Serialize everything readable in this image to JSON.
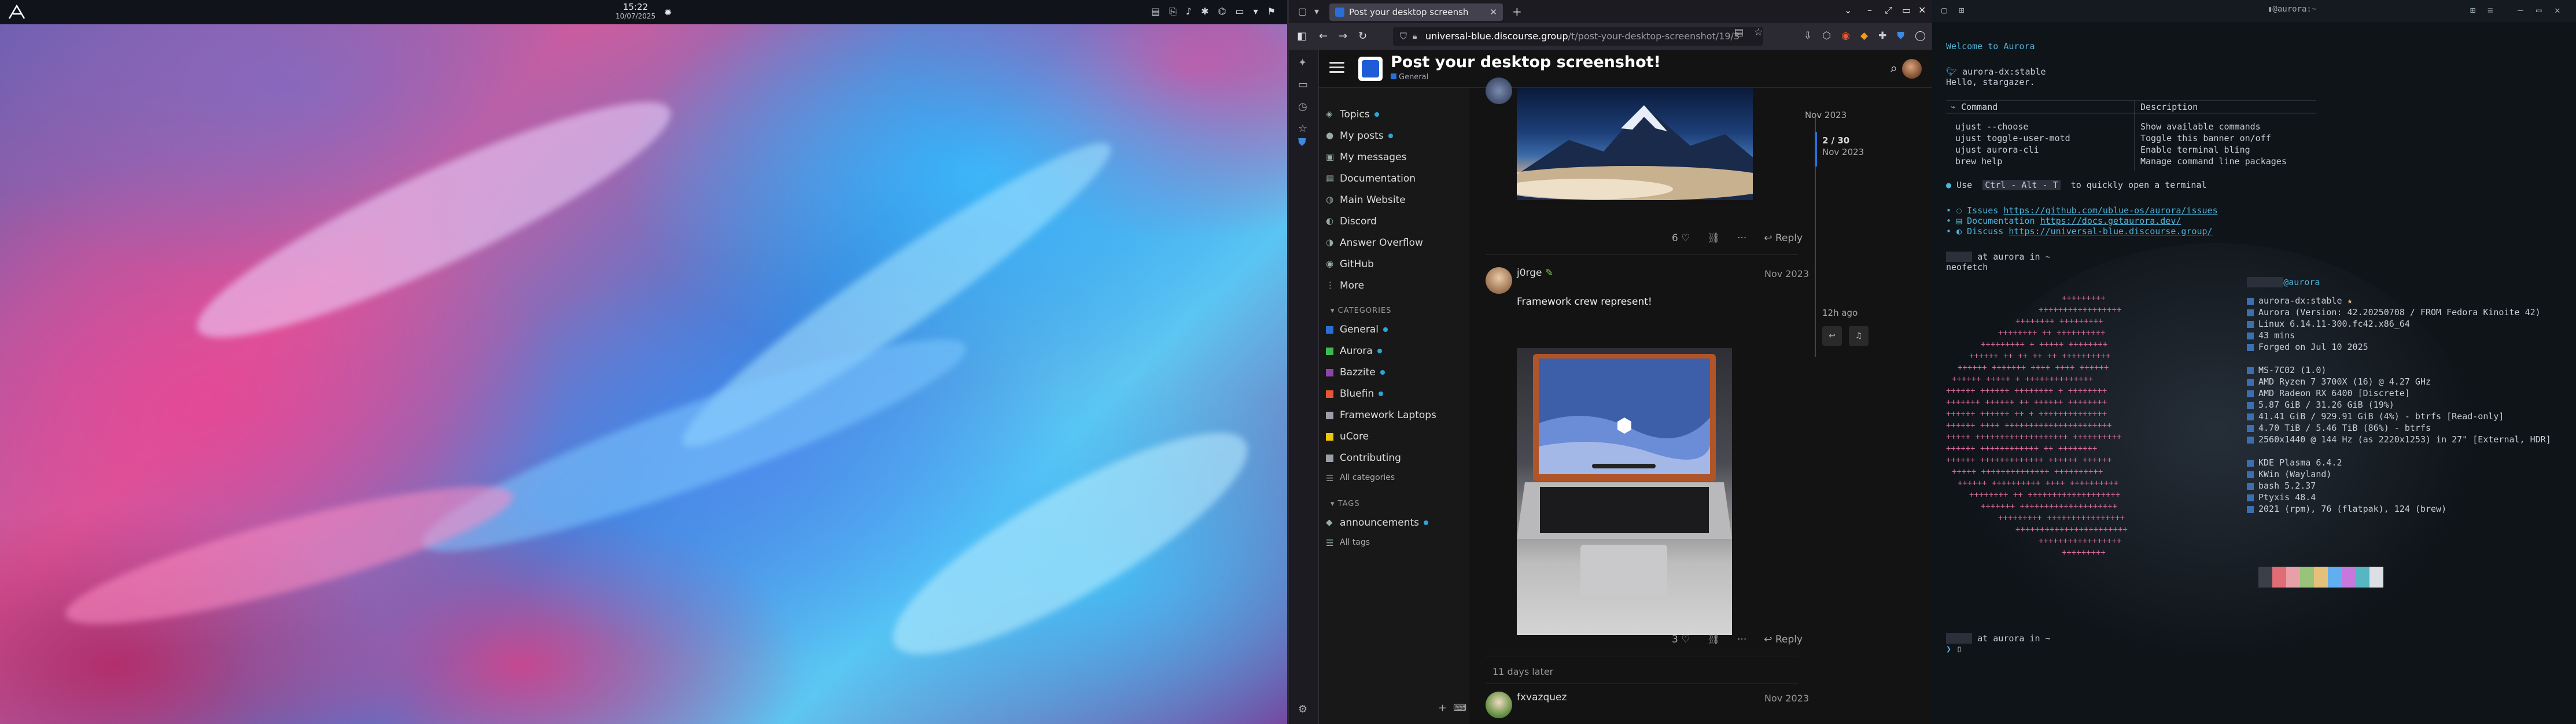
{
  "desktop": {
    "clock_time": "15:22",
    "clock_date": "10/07/2025"
  },
  "browser": {
    "tab_title": "Post your desktop screensh",
    "url_host": "universal-blue.discourse.group",
    "url_path": "/t/post-your-desktop-screenshot/19/3",
    "topic_title": "Post your desktop screenshot!",
    "topic_category": "General",
    "nav": [
      {
        "label": "Topics",
        "dot": true,
        "icon": "layers-icon"
      },
      {
        "label": "My posts",
        "dot": true,
        "icon": "user-icon"
      },
      {
        "label": "My messages",
        "dot": false,
        "icon": "inbox-icon"
      },
      {
        "label": "Documentation",
        "dot": false,
        "icon": "book-icon"
      },
      {
        "label": "Main Website",
        "dot": false,
        "icon": "globe-icon"
      },
      {
        "label": "Discord",
        "dot": false,
        "icon": "chat-icon"
      },
      {
        "label": "Answer Overflow",
        "dot": false,
        "icon": "chat-icon"
      },
      {
        "label": "GitHub",
        "dot": false,
        "icon": "github-icon"
      },
      {
        "label": "More",
        "dot": false,
        "icon": "more-icon"
      }
    ],
    "categories_label": "CATEGORIES",
    "categories": [
      {
        "label": "General",
        "dot": true,
        "color": "#2a6fd6"
      },
      {
        "label": "Aurora",
        "dot": true,
        "color": "#3dba4e"
      },
      {
        "label": "Bazzite",
        "dot": true,
        "color": "#8e44ad"
      },
      {
        "label": "Bluefin",
        "dot": true,
        "color": "#e45735"
      },
      {
        "label": "Framework Laptops",
        "dot": false,
        "color": "#9aa0aa"
      },
      {
        "label": "uCore",
        "dot": false,
        "color": "#f1c40f"
      },
      {
        "label": "Contributing",
        "dot": false,
        "color": "#9aa0aa"
      }
    ],
    "all_categories": "All categories",
    "tags_label": "TAGS",
    "tags": [
      {
        "label": "announcements",
        "dot": true
      }
    ],
    "all_tags": "All tags",
    "post1": {
      "likes": "6",
      "reply": "Reply"
    },
    "post2": {
      "username": "j0rge",
      "date": "Nov 2023",
      "text": "Framework crew represent!",
      "likes": "3",
      "reply": "Reply"
    },
    "gap": "11 days later",
    "post3": {
      "username": "fxvazquez",
      "date": "Nov 2023"
    },
    "timeline": {
      "top_date": "Nov 2023",
      "position": "2 / 30",
      "position_date": "Nov 2023",
      "bottom": "12h ago"
    }
  },
  "terminal": {
    "welcome": "Welcome to Aurora",
    "prompt1_user": "aurora-dx:stable",
    "hello": "Hello, stargazer.",
    "table_header_cmd": "Command",
    "table_header_desc": "Description",
    "commands": [
      {
        "cmd": "ujust --choose",
        "desc": "Show available commands"
      },
      {
        "cmd": "ujust toggle-user-motd",
        "desc": "Toggle this banner on/off"
      },
      {
        "cmd": "ujust aurora-cli",
        "desc": "Enable terminal bling"
      },
      {
        "cmd": "brew help",
        "desc": "Manage command line packages"
      }
    ],
    "tip_pre": "Use",
    "tip_key": "Ctrl - Alt - T",
    "tip_post": "to quickly open a terminal",
    "links": [
      {
        "label": "Issues",
        "url": "https://github.com/ublue-os/aurora/issues"
      },
      {
        "label": "Documentation",
        "url": "https://docs.getaurora.dev/"
      },
      {
        "label": "Discuss",
        "url": "https://universal-blue.discourse.group/"
      }
    ],
    "prompt": "at aurora in ~",
    "neofetch_cmd": "neofetch",
    "host_line": "@aurora",
    "info": [
      "aurora-dx:stable",
      "Aurora (Version: 42.20250708 / FROM Fedora Kinoite 42)",
      "Linux 6.14.11-300.fc42.x86_64",
      "43 mins",
      "Forged on Jul 10 2025",
      "",
      "MS-7C02 (1.0)",
      "AMD Ryzen 7 3700X (16) @ 4.27 GHz",
      "AMD Radeon RX 6400 [Discrete]",
      "5.87 GiB / 31.26 GiB (19%)",
      "41.41 GiB / 929.91 GiB (4%) - btrfs [Read-only]",
      "4.70 TiB / 5.46 TiB (86%) - btrfs",
      "2560x1440 @ 144 Hz (as 2220x1253) in 27\" [External, HDR]",
      "",
      "KDE Plasma 6.4.2",
      "KWin (Wayland)",
      "bash 5.2.37",
      "Ptyxis 48.4",
      "2021 (rpm), 76 (flatpak), 124 (brew)"
    ],
    "palette": [
      "#3a3f48",
      "#e06c75",
      "#e8a0a8",
      "#98c379",
      "#e5c07b",
      "#61afef",
      "#c678dd",
      "#56b6c2",
      "#dcdfe4"
    ]
  }
}
